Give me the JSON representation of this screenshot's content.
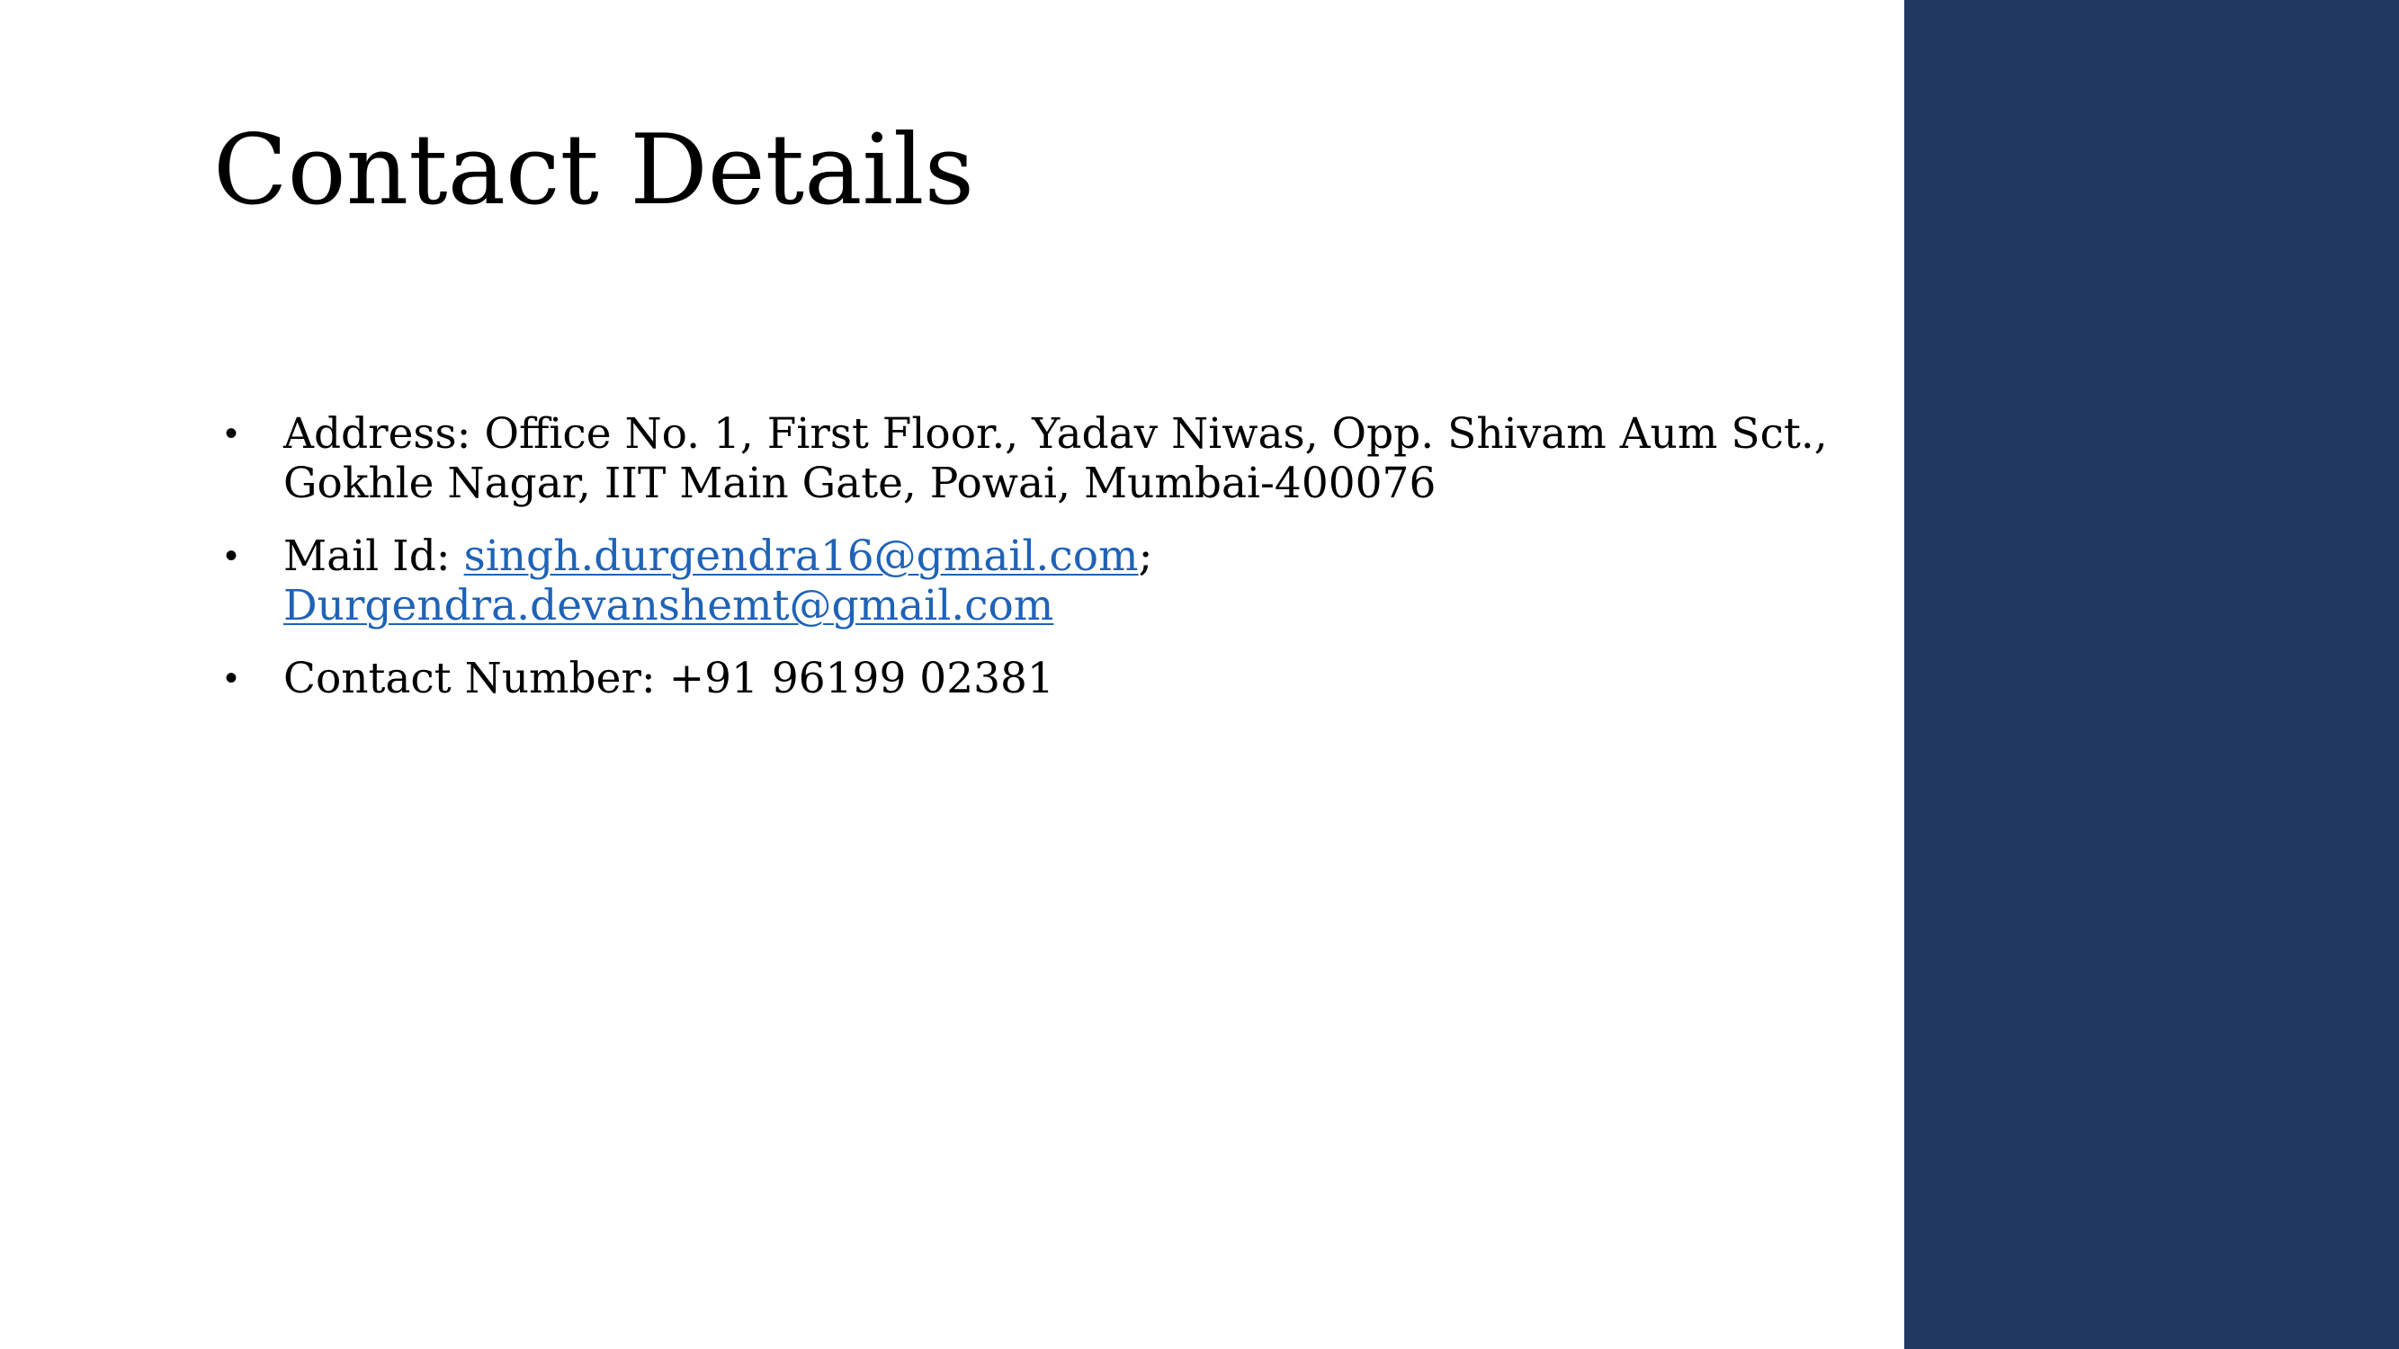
{
  "slide": {
    "title": "Contact Details",
    "accent_color": "#213861",
    "link_color": "#1F63B6",
    "bullet_glyph": "•",
    "address": {
      "label": "Address:",
      "line1_rest": "Office No. 1, First Floor., Yadav Niwas, Opp. Shivam Aum Sct.,",
      "line2": "Gokhle Nagar, IIT Main Gate, Powai, Mumbai-400076"
    },
    "mail": {
      "label": "Mail Id:",
      "email1": "singh.durgendra16@gmail.com",
      "separator": ";",
      "email2": "Durgendra.devanshemt@gmail.com"
    },
    "contact": {
      "label": "Contact Number:",
      "number": "+91 96199 02381"
    }
  }
}
